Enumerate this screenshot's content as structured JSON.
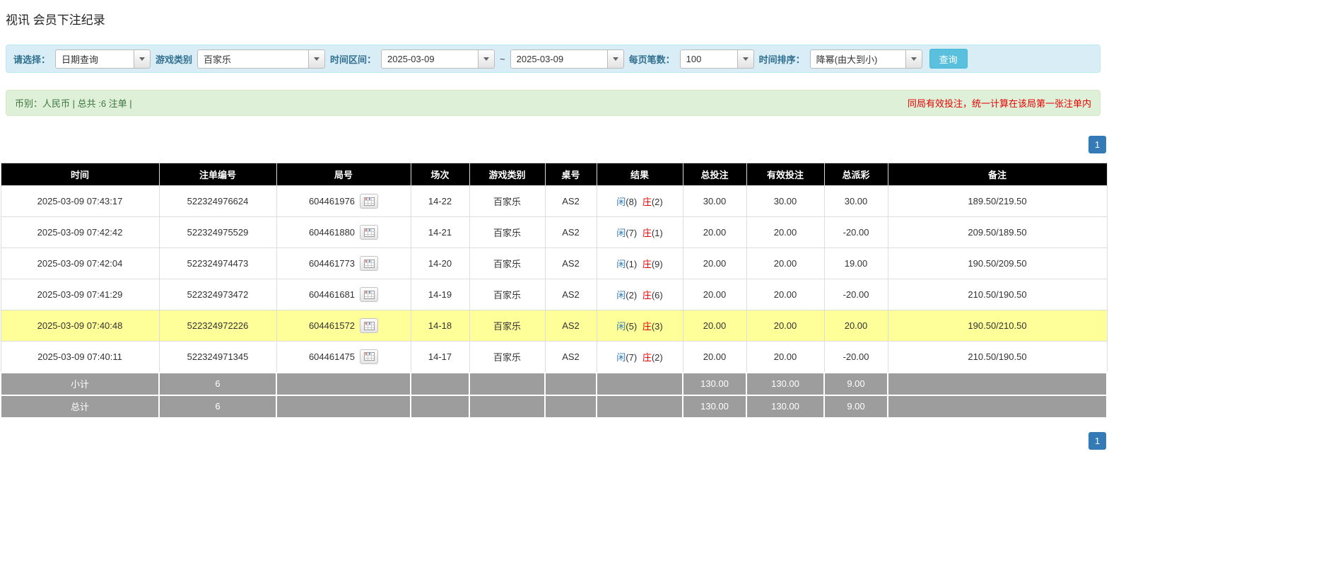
{
  "colors": {
    "accent": "#337ab7",
    "red": "#e80000",
    "highlight": "#ffff99",
    "header_bg": "#000000",
    "sum_bg": "#9d9d9d",
    "filter_bg": "#d9edf7",
    "info_bg": "#dff0d8",
    "query_bg": "#5bc0de"
  },
  "page": {
    "title": "视讯 会员下注纪录"
  },
  "filters": {
    "select_label": "请选择：",
    "select_value": "日期查询",
    "game_type_label": "游戏类别",
    "game_type_value": "百家乐",
    "time_range_label": "时间区间：",
    "date_from": "2025-03-09",
    "range_separator": "~",
    "date_to": "2025-03-09",
    "page_size_label": "每页笔数：",
    "page_size_value": "100",
    "sort_label": "时间排序：",
    "sort_value": "降幂(由大到小)",
    "query_button_label": "查询"
  },
  "summary": {
    "currency_info": "币别：人民币 | 总共 :6 注单 |",
    "notice": "同局有效投注，统一计算在该局第一张注单内"
  },
  "pagination": {
    "current_page": "1"
  },
  "table": {
    "headers": [
      "时间",
      "注单编号",
      "局号",
      "场次",
      "游戏类别",
      "桌号",
      "结果",
      "总投注",
      "有效投注",
      "总派彩",
      "备注"
    ],
    "rows": [
      {
        "time": "2025-03-09 07:43:17",
        "bet_id": "522324976624",
        "round_id": "604461976",
        "session": "14-22",
        "game_type": "百家乐",
        "table_no": "AS2",
        "result": {
          "player_label": "闲",
          "player_value": "(8)",
          "banker_label": "庄",
          "banker_value": "(2)"
        },
        "total_bet": "30.00",
        "valid_bet": "30.00",
        "payout": "30.00",
        "remark": "189.50/219.50",
        "highlighted": false
      },
      {
        "time": "2025-03-09 07:42:42",
        "bet_id": "522324975529",
        "round_id": "604461880",
        "session": "14-21",
        "game_type": "百家乐",
        "table_no": "AS2",
        "result": {
          "player_label": "闲",
          "player_value": "(7)",
          "banker_label": "庄",
          "banker_value": "(1)"
        },
        "total_bet": "20.00",
        "valid_bet": "20.00",
        "payout": "-20.00",
        "remark": "209.50/189.50",
        "highlighted": false
      },
      {
        "time": "2025-03-09 07:42:04",
        "bet_id": "522324974473",
        "round_id": "604461773",
        "session": "14-20",
        "game_type": "百家乐",
        "table_no": "AS2",
        "result": {
          "player_label": "闲",
          "player_value": "(1)",
          "banker_label": "庄",
          "banker_value": "(9)"
        },
        "total_bet": "20.00",
        "valid_bet": "20.00",
        "payout": "19.00",
        "remark": "190.50/209.50",
        "highlighted": false
      },
      {
        "time": "2025-03-09 07:41:29",
        "bet_id": "522324973472",
        "round_id": "604461681",
        "session": "14-19",
        "game_type": "百家乐",
        "table_no": "AS2",
        "result": {
          "player_label": "闲",
          "player_value": "(2)",
          "banker_label": "庄",
          "banker_value": "(6)"
        },
        "total_bet": "20.00",
        "valid_bet": "20.00",
        "payout": "-20.00",
        "remark": "210.50/190.50",
        "highlighted": false
      },
      {
        "time": "2025-03-09 07:40:48",
        "bet_id": "522324972226",
        "round_id": "604461572",
        "session": "14-18",
        "game_type": "百家乐",
        "table_no": "AS2",
        "result": {
          "player_label": "闲",
          "player_value": "(5)",
          "banker_label": "庄",
          "banker_value": "(3)"
        },
        "total_bet": "20.00",
        "valid_bet": "20.00",
        "payout": "20.00",
        "remark": "190.50/210.50",
        "highlighted": true
      },
      {
        "time": "2025-03-09 07:40:11",
        "bet_id": "522324971345",
        "round_id": "604461475",
        "session": "14-17",
        "game_type": "百家乐",
        "table_no": "AS2",
        "result": {
          "player_label": "闲",
          "player_value": "(7)",
          "banker_label": "庄",
          "banker_value": "(2)"
        },
        "total_bet": "20.00",
        "valid_bet": "20.00",
        "payout": "-20.00",
        "remark": "210.50/190.50",
        "highlighted": false
      }
    ],
    "subtotal": {
      "label": "小计",
      "count": "6",
      "total_bet": "130.00",
      "valid_bet": "130.00",
      "payout": "9.00"
    },
    "total": {
      "label": "总计",
      "count": "6",
      "total_bet": "130.00",
      "valid_bet": "130.00",
      "payout": "9.00"
    }
  }
}
